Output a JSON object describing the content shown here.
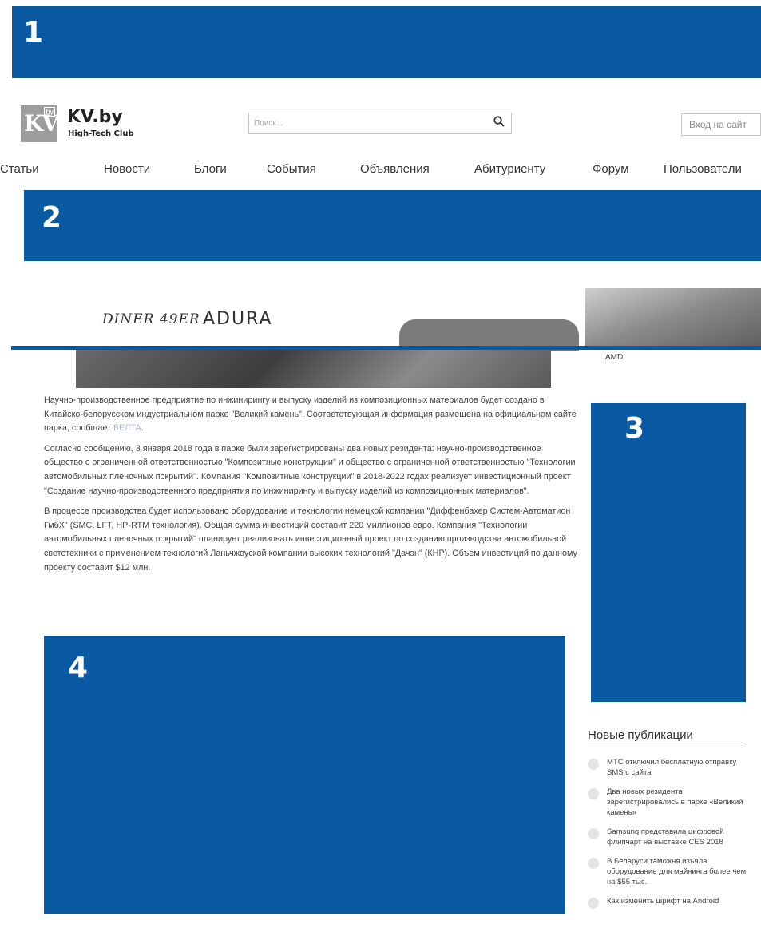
{
  "blocks": {
    "b1": "1",
    "b2": "2",
    "b3": "3",
    "b4": "4"
  },
  "colors": {
    "block": "#0a5aa3"
  },
  "header": {
    "logo_mark": "KV",
    "logo_badge": "by",
    "site_name": "KV.by",
    "site_subtitle": "High-Tech Club",
    "search_placeholder": "Поиск...",
    "search_icon": "magnifier-icon",
    "login_label": "Вход на сайт"
  },
  "nav": [
    "Статьи",
    "Новости",
    "Блоги",
    "События",
    "Объявления",
    "Абитуриенту",
    "Форум",
    "Пользователи"
  ],
  "banner": {
    "diner": "DINER 49ER",
    "adura": "ADURA",
    "caption": "AMD"
  },
  "article": {
    "p1": "Научно-производственное предприятие по инжинирингу и выпуску изделий из композиционных материалов будет создано в Китайско-белорусском индустриальном парке \"Великий камень\". Соответствующая информация размещена на официальном сайте парка, сообщает",
    "p1_link": "БЕЛТА",
    "p1_end": ".",
    "p2": "Согласно сообщению, 3 января 2018 года в парке были зарегистрированы два новых резидента: научно-производственное общество с ограниченной ответственностью \"Композитные конструкции\" и общество с ограниченной ответственностью \"Технологии автомобильных пленочных покрытий\". Компания \"Композитные конструкции\" в 2018-2022 годах реализует инвестиционный проект \"Создание научно-производственного предприятия по инжинирингу и выпуску изделий из композиционных материалов\".",
    "p3": "В процессе производства будет использовано оборудование и технологии немецкой компании \"Диффенбахер Систем-Автоматион ГмбХ\" (SMC, LFT, HP-RTM технология). Общая сумма инвестиций составит 220 миллионов евро. Компания \"Технологии автомобильных пленочных покрытий\" планирует реализовать инвестиционный проект по созданию производства автомобильной светотехники с применением технологий Ланьчжоуской компании высоких технологий \"Дачэн\" (КНР). Объем инвестиций по данному проекту составит $12 млн."
  },
  "sidebar": {
    "title": "Новые публикации",
    "items": [
      "МТС отключил бесплатную отправку SMS с сайта",
      "Два новых резидента зарегистрировались в парке «Великий камень»",
      "Samsung представила цифровой флипчарт на выставке CES 2018",
      "В Беларуси таможня изъяла оборудование для майнинга более чем на $55 тыс.",
      "Как изменить шрифт на Android"
    ]
  }
}
